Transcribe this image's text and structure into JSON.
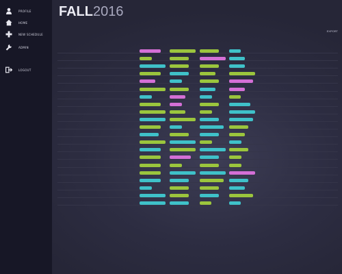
{
  "colors": {
    "sidebar_bg": "#171726",
    "main_bg": "#2d2d42",
    "bar_green": "#9bc53d",
    "bar_cyan": "#3fc1c9",
    "bar_magenta": "#d46fd6"
  },
  "sidebar": {
    "items": [
      {
        "icon": "user-icon",
        "label": "PROFILE"
      },
      {
        "icon": "home-icon",
        "label": "HOME"
      },
      {
        "icon": "plus-icon",
        "label": "NEW SCHEDULE"
      },
      {
        "icon": "wrench-icon",
        "label": "ADMIN"
      }
    ],
    "logout": {
      "icon": "logout-icon",
      "label": "LOGOUT"
    }
  },
  "header": {
    "title_bold": "FALL",
    "title_year": "2016",
    "top_right_link": "EXPORT"
  },
  "table": {
    "rows": [
      {
        "bars": [
          {
            "w": 0.7,
            "c": "m"
          },
          {
            "w": 0.86,
            "c": "g"
          },
          {
            "w": 0.64,
            "c": "g"
          },
          {
            "w": 0.38,
            "c": "c"
          }
        ]
      },
      {
        "bars": [
          {
            "w": 0.42,
            "c": "g"
          },
          {
            "w": 0.64,
            "c": "g"
          },
          {
            "w": 0.86,
            "c": "m"
          },
          {
            "w": 0.52,
            "c": "c"
          }
        ]
      },
      {
        "bars": [
          {
            "w": 0.86,
            "c": "c"
          },
          {
            "w": 0.64,
            "c": "g"
          },
          {
            "w": 0.64,
            "c": "g"
          },
          {
            "w": 0.52,
            "c": "c"
          }
        ]
      },
      {
        "bars": [
          {
            "w": 0.7,
            "c": "g"
          },
          {
            "w": 0.64,
            "c": "c"
          },
          {
            "w": 0.52,
            "c": "g"
          },
          {
            "w": 0.86,
            "c": "g"
          }
        ]
      },
      {
        "bars": [
          {
            "w": 0.52,
            "c": "m"
          },
          {
            "w": 0.42,
            "c": "c"
          },
          {
            "w": 0.64,
            "c": "g"
          },
          {
            "w": 0.8,
            "c": "m"
          }
        ]
      },
      {
        "bars": [
          {
            "w": 0.86,
            "c": "g"
          },
          {
            "w": 0.64,
            "c": "g"
          },
          {
            "w": 0.52,
            "c": "c"
          },
          {
            "w": 0.52,
            "c": "m"
          }
        ]
      },
      {
        "bars": [
          {
            "w": 0.42,
            "c": "c"
          },
          {
            "w": 0.52,
            "c": "m"
          },
          {
            "w": 0.42,
            "c": "c"
          },
          {
            "w": 0.38,
            "c": "g"
          }
        ]
      },
      {
        "bars": [
          {
            "w": 0.7,
            "c": "g"
          },
          {
            "w": 0.42,
            "c": "m"
          },
          {
            "w": 0.64,
            "c": "g"
          },
          {
            "w": 0.7,
            "c": "c"
          }
        ]
      },
      {
        "bars": [
          {
            "w": 0.86,
            "c": "g"
          },
          {
            "w": 0.52,
            "c": "g"
          },
          {
            "w": 0.42,
            "c": "g"
          },
          {
            "w": 0.86,
            "c": "c"
          }
        ]
      },
      {
        "bars": [
          {
            "w": 0.86,
            "c": "c"
          },
          {
            "w": 0.86,
            "c": "g"
          },
          {
            "w": 0.64,
            "c": "c"
          },
          {
            "w": 0.8,
            "c": "c"
          }
        ]
      },
      {
        "bars": [
          {
            "w": 0.7,
            "c": "g"
          },
          {
            "w": 0.42,
            "c": "c"
          },
          {
            "w": 0.8,
            "c": "c"
          },
          {
            "w": 0.64,
            "c": "g"
          }
        ]
      },
      {
        "bars": [
          {
            "w": 0.64,
            "c": "c"
          },
          {
            "w": 0.64,
            "c": "g"
          },
          {
            "w": 0.64,
            "c": "c"
          },
          {
            "w": 0.52,
            "c": "g"
          }
        ]
      },
      {
        "bars": [
          {
            "w": 0.86,
            "c": "g"
          },
          {
            "w": 0.86,
            "c": "c"
          },
          {
            "w": 0.42,
            "c": "g"
          },
          {
            "w": 0.42,
            "c": "c"
          }
        ]
      },
      {
        "bars": [
          {
            "w": 0.7,
            "c": "c"
          },
          {
            "w": 0.86,
            "c": "g"
          },
          {
            "w": 0.86,
            "c": "c"
          },
          {
            "w": 0.64,
            "c": "g"
          }
        ]
      },
      {
        "bars": [
          {
            "w": 0.7,
            "c": "g"
          },
          {
            "w": 0.7,
            "c": "m"
          },
          {
            "w": 0.64,
            "c": "c"
          },
          {
            "w": 0.42,
            "c": "g"
          }
        ]
      },
      {
        "bars": [
          {
            "w": 0.7,
            "c": "g"
          },
          {
            "w": 0.42,
            "c": "g"
          },
          {
            "w": 0.64,
            "c": "g"
          },
          {
            "w": 0.42,
            "c": "g"
          }
        ]
      },
      {
        "bars": [
          {
            "w": 0.7,
            "c": "g"
          },
          {
            "w": 0.86,
            "c": "c"
          },
          {
            "w": 0.86,
            "c": "c"
          },
          {
            "w": 0.86,
            "c": "m"
          }
        ]
      },
      {
        "bars": [
          {
            "w": 0.7,
            "c": "c"
          },
          {
            "w": 0.64,
            "c": "c"
          },
          {
            "w": 0.8,
            "c": "g"
          },
          {
            "w": 0.64,
            "c": "c"
          }
        ]
      },
      {
        "bars": [
          {
            "w": 0.42,
            "c": "c"
          },
          {
            "w": 0.64,
            "c": "g"
          },
          {
            "w": 0.64,
            "c": "g"
          },
          {
            "w": 0.52,
            "c": "c"
          }
        ]
      },
      {
        "bars": [
          {
            "w": 0.86,
            "c": "c"
          },
          {
            "w": 0.64,
            "c": "g"
          },
          {
            "w": 0.64,
            "c": "c"
          },
          {
            "w": 0.8,
            "c": "g"
          }
        ]
      },
      {
        "bars": [
          {
            "w": 0.86,
            "c": "c"
          },
          {
            "w": 0.64,
            "c": "c"
          },
          {
            "w": 0.38,
            "c": "g"
          },
          {
            "w": 0.38,
            "c": "c"
          }
        ]
      }
    ]
  }
}
